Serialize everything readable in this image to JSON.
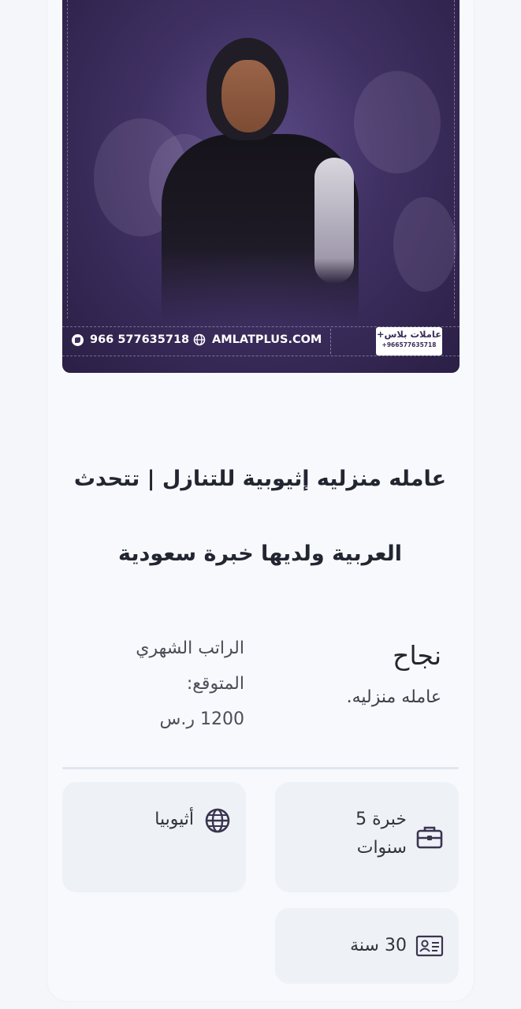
{
  "banner": {
    "phone": "966 577635718",
    "website": "AMLATPLUS.COM",
    "logo_brand": "عاملات بلاس+",
    "logo_number": "+966577635718"
  },
  "listing": {
    "title_line1": "عامله منزليه إثيوبية للتنازل | تتحدث",
    "title_line2": "العربية ولديها خبرة سعودية",
    "worker_name": "نجاح",
    "worker_role": "عامله منزليه.",
    "salary_label_line1": "الراتب الشهري",
    "salary_label_line2": "المتوقع:",
    "salary_value": "1200 ر.س"
  },
  "details": {
    "experience_line1": "خبرة 5",
    "experience_line2": "سنوات",
    "nationality": "أثيوبيا",
    "age": "30 سنة"
  },
  "icons": {
    "experience": "briefcase-icon",
    "nationality": "globe-icon",
    "age": "id-card-icon",
    "phone": "phone-icon",
    "website": "globe-icon"
  },
  "colors": {
    "banner_purple": "#3f3062",
    "text_dark": "#222631",
    "chip_bg": "#eef1f6",
    "icon_color": "#3a3450"
  }
}
